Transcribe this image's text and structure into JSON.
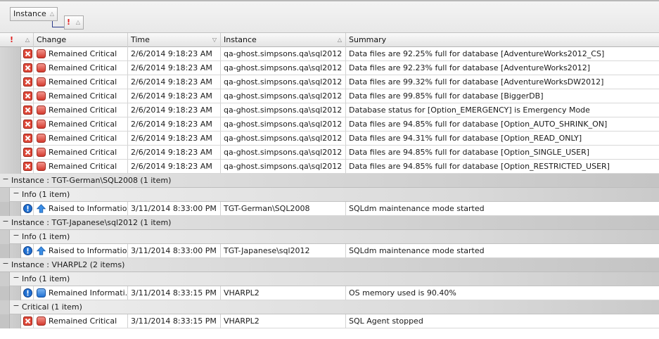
{
  "groupby": {
    "instance_chip": "Instance",
    "severity_chip": "!"
  },
  "columns": {
    "severity": "!",
    "change": "Change",
    "time": "Time",
    "instance": "Instance",
    "summary": "Summary"
  },
  "colors": {
    "critical": "#e04a3b",
    "info": "#1f6fd1",
    "accent_line": "#2a3a8a"
  },
  "rows": [
    {
      "kind": "data",
      "indent": 1,
      "severity_icon": "critical-x-icon",
      "change_icon": "red-state-icon",
      "change": "Remained Critical",
      "time": "2/6/2014 9:18:23 AM",
      "instance": "qa-ghost.simpsons.qa\\sql2012",
      "summary": "Data files are 92.25% full for database [AdventureWorks2012_CS]"
    },
    {
      "kind": "data",
      "indent": 1,
      "severity_icon": "critical-x-icon",
      "change_icon": "red-state-icon",
      "change": "Remained Critical",
      "time": "2/6/2014 9:18:23 AM",
      "instance": "qa-ghost.simpsons.qa\\sql2012",
      "summary": "Data files are 92.23% full for database [AdventureWorks2012]"
    },
    {
      "kind": "data",
      "indent": 1,
      "severity_icon": "critical-x-icon",
      "change_icon": "red-state-icon",
      "change": "Remained Critical",
      "time": "2/6/2014 9:18:23 AM",
      "instance": "qa-ghost.simpsons.qa\\sql2012",
      "summary": "Data files are 99.32% full for database [AdventureWorksDW2012]"
    },
    {
      "kind": "data",
      "indent": 1,
      "severity_icon": "critical-x-icon",
      "change_icon": "red-state-icon",
      "change": "Remained Critical",
      "time": "2/6/2014 9:18:23 AM",
      "instance": "qa-ghost.simpsons.qa\\sql2012",
      "summary": "Data files are 99.85% full for database [BiggerDB]"
    },
    {
      "kind": "data",
      "indent": 1,
      "severity_icon": "critical-x-icon",
      "change_icon": "red-state-icon",
      "change": "Remained Critical",
      "time": "2/6/2014 9:18:23 AM",
      "instance": "qa-ghost.simpsons.qa\\sql2012",
      "summary": "Database status for [Option_EMERGENCY] is Emergency Mode"
    },
    {
      "kind": "data",
      "indent": 1,
      "severity_icon": "critical-x-icon",
      "change_icon": "red-state-icon",
      "change": "Remained Critical",
      "time": "2/6/2014 9:18:23 AM",
      "instance": "qa-ghost.simpsons.qa\\sql2012",
      "summary": "Data files are 94.85% full for database [Option_AUTO_SHRINK_ON]"
    },
    {
      "kind": "data",
      "indent": 1,
      "severity_icon": "critical-x-icon",
      "change_icon": "red-state-icon",
      "change": "Remained Critical",
      "time": "2/6/2014 9:18:23 AM",
      "instance": "qa-ghost.simpsons.qa\\sql2012",
      "summary": "Data files are 94.31% full for database [Option_READ_ONLY]"
    },
    {
      "kind": "data",
      "indent": 1,
      "severity_icon": "critical-x-icon",
      "change_icon": "red-state-icon",
      "change": "Remained Critical",
      "time": "2/6/2014 9:18:23 AM",
      "instance": "qa-ghost.simpsons.qa\\sql2012",
      "summary": "Data files are 94.85% full for database [Option_SINGLE_USER]"
    },
    {
      "kind": "data",
      "indent": 1,
      "severity_icon": "critical-x-icon",
      "change_icon": "red-state-icon",
      "change": "Remained Critical",
      "time": "2/6/2014 9:18:23 AM",
      "instance": "qa-ghost.simpsons.qa\\sql2012",
      "summary": "Data files are 94.85% full for database [Option_RESTRICTED_USER]"
    },
    {
      "kind": "group",
      "label": "Instance : TGT-German\\SQL2008 (1 item)"
    },
    {
      "kind": "subgroup",
      "label": "Info (1 item)"
    },
    {
      "kind": "data",
      "indent": 2,
      "severity_icon": "info-bang-icon",
      "change_icon": "up-arrow-icon",
      "change": "Raised to Informatio...",
      "time": "3/11/2014 8:33:00 PM",
      "instance": "TGT-German\\SQL2008",
      "summary": "SQLdm maintenance mode started"
    },
    {
      "kind": "group",
      "label": "Instance : TGT-Japanese\\sql2012 (1 item)"
    },
    {
      "kind": "subgroup",
      "label": "Info (1 item)"
    },
    {
      "kind": "data",
      "indent": 2,
      "severity_icon": "info-bang-icon",
      "change_icon": "up-arrow-icon",
      "change": "Raised to Informatio...",
      "time": "3/11/2014 8:33:00 PM",
      "instance": "TGT-Japanese\\sql2012",
      "summary": "SQLdm maintenance mode started"
    },
    {
      "kind": "group",
      "label": "Instance : VHARPL2 (2 items)"
    },
    {
      "kind": "subgroup",
      "label": "Info (1 item)"
    },
    {
      "kind": "data",
      "indent": 2,
      "severity_icon": "info-bang-icon",
      "change_icon": "blue-state-icon",
      "change": "Remained Informati...",
      "time": "3/11/2014 8:33:15 PM",
      "instance": "VHARPL2",
      "summary": "OS memory used is 90.40%"
    },
    {
      "kind": "subgroup",
      "label": "Critical (1 item)"
    },
    {
      "kind": "data",
      "indent": 2,
      "severity_icon": "critical-x-icon",
      "change_icon": "red-state-icon",
      "change": "Remained Critical",
      "time": "3/11/2014 8:33:15 PM",
      "instance": "VHARPL2",
      "summary": "SQL Agent stopped"
    }
  ]
}
